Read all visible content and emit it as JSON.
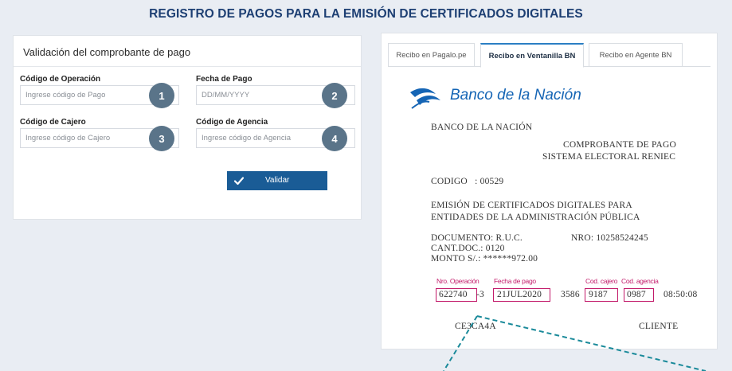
{
  "page_title": "REGISTRO DE PAGOS PARA LA EMISIÓN DE CERTIFICADOS DIGITALES",
  "validation": {
    "title": "Validación del comprobante de pago",
    "fields": [
      {
        "label": "Código de Operación",
        "placeholder": "Ingrese código de Pago",
        "badge": "1"
      },
      {
        "label": "Fecha de Pago",
        "placeholder": "DD/MM/YYYY",
        "badge": "2"
      },
      {
        "label": "Código de Cajero",
        "placeholder": "Ingrese código de Cajero",
        "badge": "3"
      },
      {
        "label": "Código de Agencia",
        "placeholder": "Ingrese código de Agencia",
        "badge": "4"
      }
    ],
    "validate_label": "Validar"
  },
  "tabs": [
    "Recibo en Pagalo.pe",
    "Recibo en Ventanilla BN",
    "Recibo en Agente BN"
  ],
  "active_tab": "Recibo en Ventanilla BN",
  "receipt": {
    "bank_name": "Banco de la Nación",
    "bank_header": "BANCO DE LA NACIÓN",
    "doc_title": "COMPROBANTE DE PAGO",
    "doc_subtitle": "SISTEMA ELECTORAL RENIEC",
    "codigo": "CODIGO   : 00529",
    "emision_line1": "EMISIÓN DE CERTIFICADOS DIGITALES PARA",
    "emision_line2": "ENTIDADES DE LA ADMINISTRACIÓN PÚBLICA",
    "documento": "DOCUMENTO: R.U.C.",
    "nro": "NRO: 10258524245",
    "cant_doc": "CANT.DOC.: 0120",
    "monto": "MONTO S/.: ******972.00",
    "annotations": {
      "nro_operacion_label": "Nro. Operación",
      "fecha_pago_label": "Fecha de pago",
      "cod_cajero_label": "Cod. cajero",
      "cod_agencia_label": "Cod. agencia"
    },
    "values": {
      "nro_operacion": "622740",
      "suffix": "-3",
      "fecha_pago": "21JUL2020",
      "middle": "3586",
      "cod_cajero": "9187",
      "cod_agencia": "0987",
      "time": "08:50:08"
    },
    "footer_code": "CE3CA4A",
    "footer_client": "CLIENTE"
  },
  "colors": {
    "title": "#1d3f73",
    "badge": "#5a7489",
    "button": "#1a5c96",
    "annotation": "#c21a6a",
    "bank_blue": "#1565b5",
    "dashed_line": "#1a8a9a"
  }
}
